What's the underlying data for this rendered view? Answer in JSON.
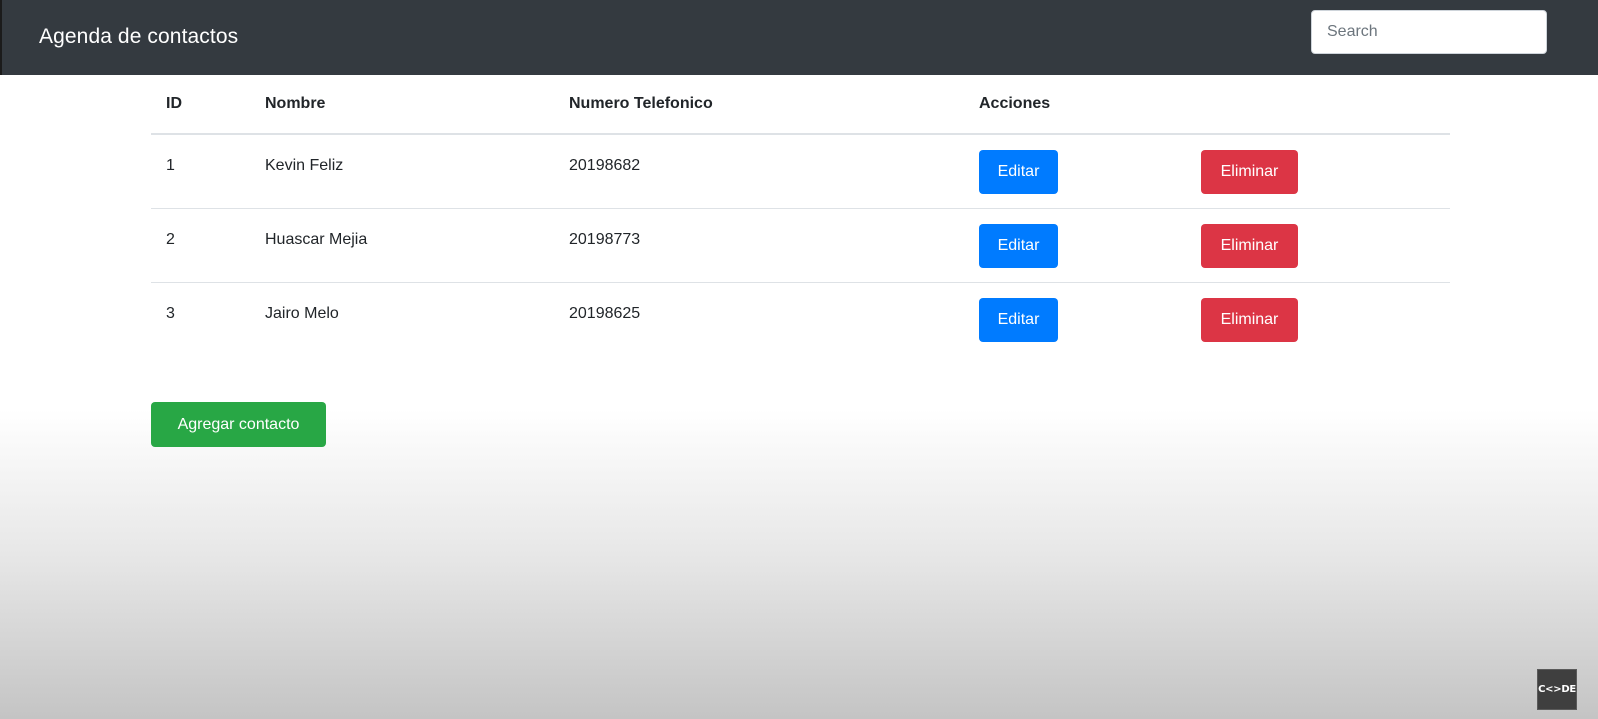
{
  "navbar": {
    "brand": "Agenda de contactos",
    "search_placeholder": "Search"
  },
  "table": {
    "headers": {
      "id": "ID",
      "name": "Nombre",
      "phone": "Numero Telefonico",
      "actions": "Acciones"
    },
    "rows": [
      {
        "id": "1",
        "name": "Kevin Feliz",
        "phone": "20198682",
        "edit": "Editar",
        "delete": "Eliminar"
      },
      {
        "id": "2",
        "name": "Huascar Mejia",
        "phone": "20198773",
        "edit": "Editar",
        "delete": "Eliminar"
      },
      {
        "id": "3",
        "name": "Jairo Melo",
        "phone": "20198625",
        "edit": "Editar",
        "delete": "Eliminar"
      }
    ]
  },
  "add_button": "Agregar contacto",
  "watermark": "C<>DE",
  "colors": {
    "navbar": "#343a40",
    "edit": "#007bff",
    "delete": "#dc3545",
    "add": "#28a745"
  }
}
